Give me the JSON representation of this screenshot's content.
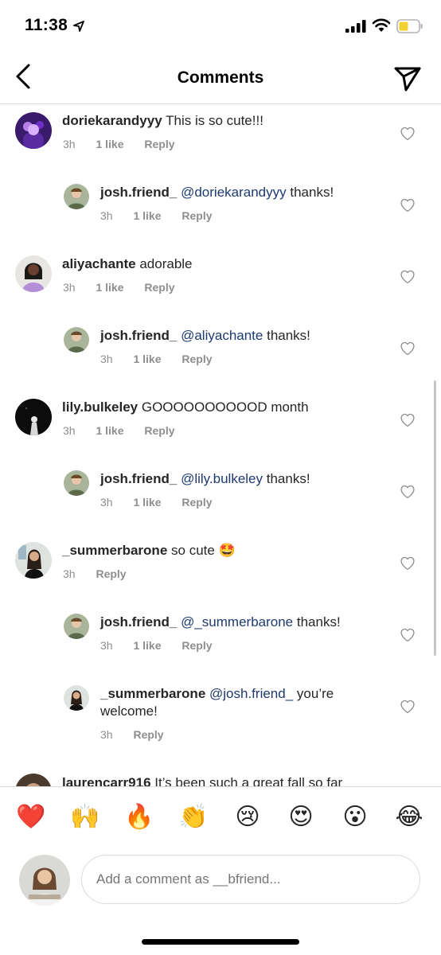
{
  "status": {
    "time": "11:38"
  },
  "header": {
    "title": "Comments"
  },
  "comments": [
    {
      "user": "doriekarandyyy",
      "mention": "",
      "text": "This is so cute!!!",
      "time": "3h",
      "likes": "1 like",
      "reply": "Reply"
    },
    {
      "user": "josh.friend_",
      "mention": "@doriekarandyyy",
      "text": "thanks!",
      "time": "3h",
      "likes": "1 like",
      "reply": "Reply"
    },
    {
      "user": "aliyachante",
      "mention": "",
      "text": "adorable",
      "time": "3h",
      "likes": "1 like",
      "reply": "Reply"
    },
    {
      "user": "josh.friend_",
      "mention": "@aliyachante",
      "text": "thanks!",
      "time": "3h",
      "likes": "1 like",
      "reply": "Reply"
    },
    {
      "user": "lily.bulkeley",
      "mention": "",
      "text": "GOOOOOOOOOOD month",
      "time": "3h",
      "likes": "1 like",
      "reply": "Reply"
    },
    {
      "user": "josh.friend_",
      "mention": "@lily.bulkeley",
      "text": "thanks!",
      "time": "3h",
      "likes": "1 like",
      "reply": "Reply"
    },
    {
      "user": "_summerbarone",
      "mention": "",
      "text": "so cute 🤩",
      "time": "3h",
      "likes": "",
      "reply": "Reply"
    },
    {
      "user": "josh.friend_",
      "mention": "@_summerbarone",
      "text": "thanks!",
      "time": "3h",
      "likes": "1 like",
      "reply": "Reply"
    },
    {
      "user": "_summerbarone",
      "mention": "@josh.friend_",
      "text": "you’re welcome!",
      "time": "3h",
      "likes": "",
      "reply": "Reply"
    },
    {
      "user": "laurencarr916",
      "mention": "",
      "text": "It’s been such a great fall so far",
      "time": "",
      "likes": "",
      "reply": ""
    }
  ],
  "emoji_bar": [
    "❤️",
    "🙌",
    "🔥",
    "👏",
    "😢",
    "😍",
    "😮",
    "😂"
  ],
  "composer": {
    "placeholder": "Add a comment as __bfriend..."
  },
  "colors": {
    "mention": "#1e3a70",
    "meta": "#8e8e8e",
    "divider": "#dbdbdb"
  }
}
